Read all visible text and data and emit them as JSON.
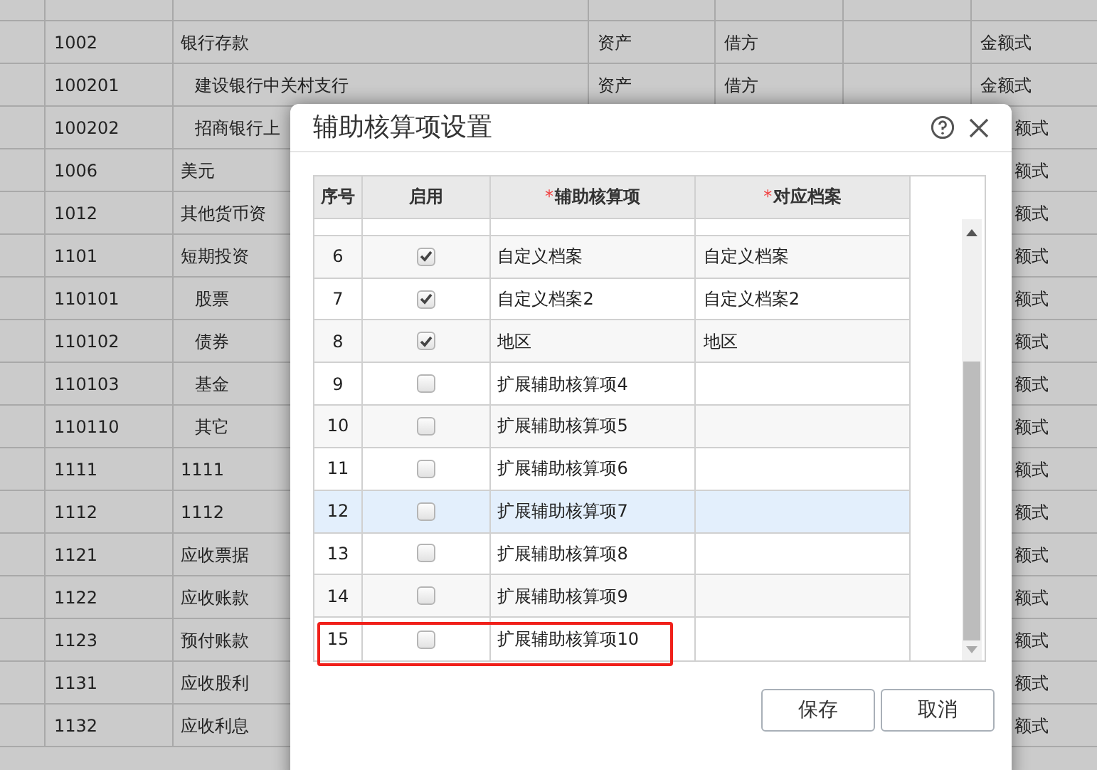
{
  "accounts": [
    {
      "code": "1002",
      "name": "银行存款",
      "type": "资产",
      "direction": "借方",
      "format": "金额式",
      "children": [
        {
          "code": "100201",
          "name": "建设银行中关村支行",
          "type": "资产",
          "direction": "借方",
          "format": "金额式"
        },
        {
          "code": "100202",
          "name": "招商银行上",
          "format": "额式"
        }
      ]
    },
    {
      "code": "1006",
      "name": "美元",
      "format": "额式"
    },
    {
      "code": "1012",
      "name": "其他货币资",
      "format": "额式"
    },
    {
      "code": "1101",
      "name": "短期投资",
      "format": "额式",
      "children": [
        {
          "code": "110101",
          "name": "股票",
          "format": "额式"
        },
        {
          "code": "110102",
          "name": "债券",
          "format": "额式"
        },
        {
          "code": "110103",
          "name": "基金",
          "format": "额式"
        },
        {
          "code": "110110",
          "name": "其它",
          "format": "额式"
        }
      ]
    },
    {
      "code": "1111",
      "name": "1111",
      "format": "额式"
    },
    {
      "code": "1112",
      "name": "1112",
      "format": "额式"
    },
    {
      "code": "1121",
      "name": "应收票据",
      "format": "额式"
    },
    {
      "code": "1122",
      "name": "应收账款",
      "format": "额式"
    },
    {
      "code": "1123",
      "name": "预付账款",
      "format": "额式"
    },
    {
      "code": "1131",
      "name": "应收股利",
      "format": "额式"
    },
    {
      "code": "1132",
      "name": "应收利息",
      "format": "额式"
    }
  ],
  "dialog": {
    "title": "辅助核算项设置",
    "columns": [
      {
        "label": "序号"
      },
      {
        "label": "启用"
      },
      {
        "label": "辅助核算项",
        "marker": "*"
      },
      {
        "label": "对应档案",
        "marker": "*"
      }
    ],
    "rows": [
      {
        "index": "6",
        "checked": true,
        "item": "自定义档案",
        "archive": "自定义档案",
        "highlighted": false,
        "outlined": false
      },
      {
        "index": "7",
        "checked": true,
        "item": "自定义档案2",
        "archive": "自定义档案2",
        "highlighted": false,
        "outlined": false
      },
      {
        "index": "8",
        "checked": true,
        "item": "地区",
        "archive": "地区",
        "highlighted": false,
        "outlined": false
      },
      {
        "index": "9",
        "checked": false,
        "item": "扩展辅助核算项4",
        "highlighted": false,
        "outlined": false
      },
      {
        "index": "10",
        "checked": false,
        "item": "扩展辅助核算项5",
        "highlighted": false,
        "outlined": false
      },
      {
        "index": "11",
        "checked": false,
        "item": "扩展辅助核算项6",
        "highlighted": false,
        "outlined": false
      },
      {
        "index": "12",
        "checked": false,
        "item": "扩展辅助核算项7",
        "highlighted": true,
        "outlined": false
      },
      {
        "index": "13",
        "checked": false,
        "item": "扩展辅助核算项8",
        "highlighted": false,
        "outlined": false
      },
      {
        "index": "14",
        "checked": false,
        "item": "扩展辅助核算项9",
        "highlighted": false,
        "outlined": false
      },
      {
        "index": "15",
        "checked": false,
        "item": "扩展辅助核算项10",
        "highlighted": false,
        "outlined": true
      }
    ],
    "buttons": [
      "保存",
      "取消"
    ]
  }
}
